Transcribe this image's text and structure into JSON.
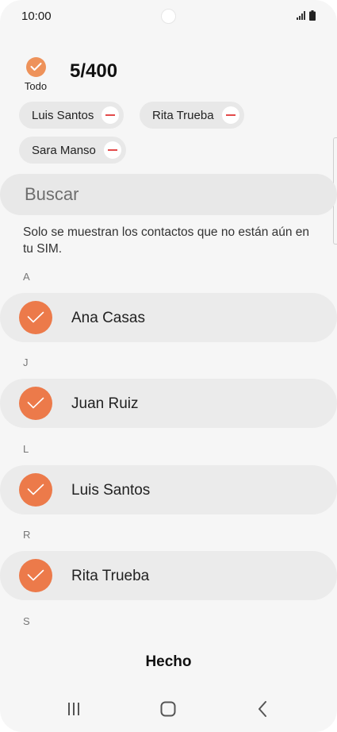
{
  "status_bar": {
    "time": "10:00",
    "icons": [
      "camera-hole",
      "signal-icon",
      "battery-icon"
    ]
  },
  "header": {
    "select_all_label": "Todo",
    "count": "5/400"
  },
  "chips": [
    {
      "label": "Luis Santos"
    },
    {
      "label": "Rita Trueba"
    },
    {
      "label": "Sara Manso"
    }
  ],
  "search": {
    "placeholder": "Buscar"
  },
  "info_text": "Solo se muestran los contactos que no están aún en tu SIM.",
  "sections": [
    {
      "header": "A",
      "contact": "Ana Casas"
    },
    {
      "header": "J",
      "contact": "Juan Ruiz"
    },
    {
      "header": "L",
      "contact": "Luis Santos"
    },
    {
      "header": "R",
      "contact": "Rita Trueba"
    },
    {
      "header": "S"
    }
  ],
  "done_label": "Hecho",
  "nav": {
    "icons": [
      "recents-icon",
      "home-icon",
      "back-icon"
    ]
  },
  "colors": {
    "accent": "#ec7a4a",
    "accent_light": "#ee925a",
    "remove_red": "#e34a4a",
    "background": "#f6f6f6",
    "row_background": "#ebebeb"
  }
}
